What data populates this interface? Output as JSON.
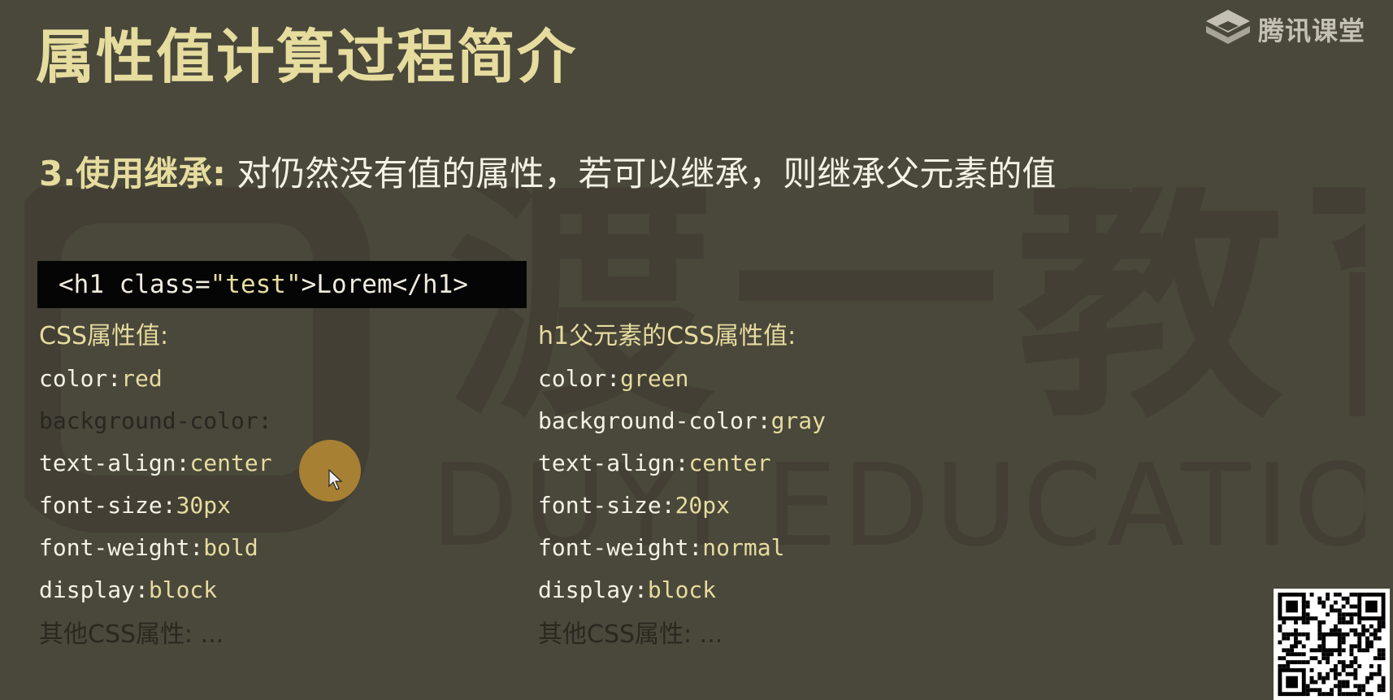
{
  "slide": {
    "title": "属性值计算过程简介",
    "brand": "腾讯课堂",
    "watermark_cn": "渡一教育",
    "watermark_en": "DUYI EDUCATION",
    "subtitle_lead": "3.使用继承:",
    "subtitle_text": "对仍然没有值的属性，若可以继承，则继承父元素的值"
  },
  "code": {
    "open": "<h1 class=",
    "attr_value": "\"test\"",
    "rest": ">Lorem</h1>"
  },
  "left_column": {
    "heading": "CSS属性值:",
    "rows": [
      {
        "prop": "color:",
        "value": "red",
        "dim": false
      },
      {
        "prop": "background-color:",
        "value": "",
        "dim": true
      },
      {
        "prop": "text-align:",
        "value": "center",
        "dim": false
      },
      {
        "prop": "font-size:",
        "value": "30px",
        "dim": false
      },
      {
        "prop": "font-weight:",
        "value": "bold",
        "dim": false
      },
      {
        "prop": "display:",
        "value": "block",
        "dim": false
      }
    ],
    "footer": "其他CSS属性: ..."
  },
  "right_column": {
    "heading": "h1父元素的CSS属性值:",
    "rows": [
      {
        "prop": "color:",
        "value": "green",
        "dim": false
      },
      {
        "prop": "background-color:",
        "value": "gray",
        "dim": false
      },
      {
        "prop": "text-align:",
        "value": "center",
        "dim": false
      },
      {
        "prop": "font-size:",
        "value": "20px",
        "dim": false
      },
      {
        "prop": "font-weight:",
        "value": "normal",
        "dim": false
      },
      {
        "prop": "display:",
        "value": "block",
        "dim": false
      }
    ],
    "footer": "其他CSS属性: ..."
  },
  "icons": {
    "brand_logo": "tencent-classroom-logo-icon",
    "cursor": "mouse-pointer-icon",
    "qr": "qr-code-icon"
  },
  "colors": {
    "background": "#4a473b",
    "title": "#e5dc9e",
    "highlight": "#e5dc9e",
    "text": "#f4f1e6",
    "code_bg": "#050505",
    "cursor_halo": "#b08634"
  }
}
